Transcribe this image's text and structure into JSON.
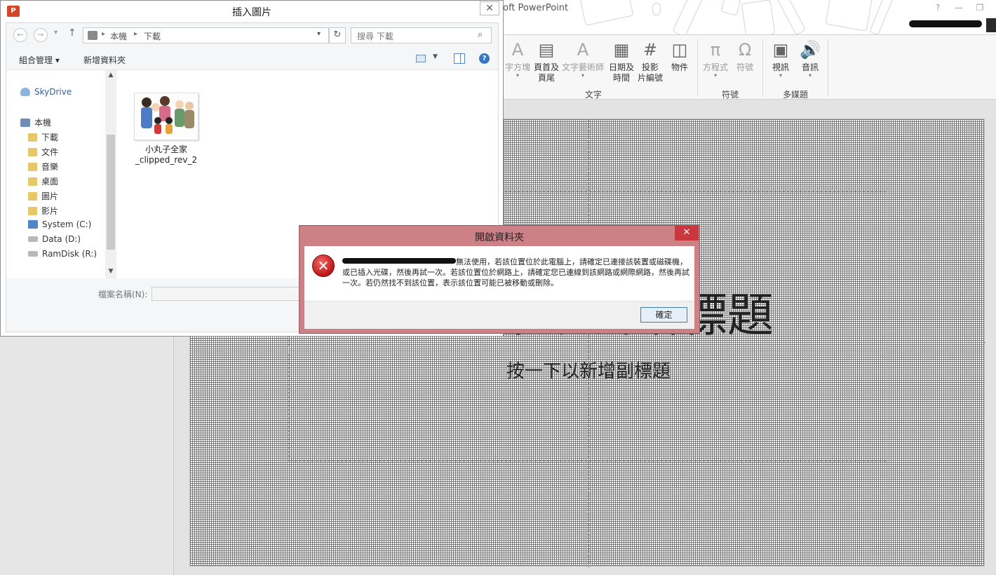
{
  "ppt": {
    "title_fragment": "oft PowerPoint",
    "window_controls": {
      "help": "?",
      "minimize": "—",
      "restore": "❐"
    },
    "ribbon": {
      "buttons": [
        {
          "label": "字方塊",
          "icon": "A",
          "dim": true
        },
        {
          "label": "頁首及\n頁尾",
          "icon": "▤"
        },
        {
          "label": "文字藝術師",
          "icon": "A",
          "dim": true
        },
        {
          "label": "日期及\n時間",
          "icon": "▦"
        },
        {
          "label": "投影\n片編號",
          "icon": "#"
        },
        {
          "label": "物件",
          "icon": "◫"
        },
        {
          "label": "方程式",
          "icon": "π",
          "dim": true
        },
        {
          "label": "符號",
          "icon": "Ω",
          "dim": true
        },
        {
          "label": "視訊",
          "icon": "▣"
        },
        {
          "label": "音訊",
          "icon": "🔊"
        }
      ],
      "groups": {
        "text": "文字",
        "symbols": "符號",
        "media": "多媒題"
      }
    },
    "slide": {
      "title_placeholder": "按一下以新增標題",
      "title_visible_suffix": "標題",
      "subtitle_placeholder": "按一下以新增副標題"
    }
  },
  "insert_dialog": {
    "app_icon": "P",
    "title": "插入圖片",
    "close": "✕",
    "nav": {
      "back": "←",
      "forward": "→",
      "recent": "▾",
      "up": "↑"
    },
    "breadcrumb": [
      "本機",
      "下載"
    ],
    "refresh": "↻",
    "search_placeholder": "搜尋 下載",
    "search_icon": "⌕",
    "commands": {
      "organize": "組合管理 ▾",
      "new_folder": "新增資料夾"
    },
    "help_icon": "?",
    "tree": [
      {
        "label": "SkyDrive",
        "icon": "cloud"
      },
      {
        "label": "本機",
        "icon": "pc"
      },
      {
        "label": "下載",
        "icon": "folder"
      },
      {
        "label": "文件",
        "icon": "folder"
      },
      {
        "label": "音樂",
        "icon": "folder"
      },
      {
        "label": "桌面",
        "icon": "folder"
      },
      {
        "label": "圖片",
        "icon": "folder"
      },
      {
        "label": "影片",
        "icon": "folder"
      },
      {
        "label": "System (C:)",
        "icon": "sys"
      },
      {
        "label": "Data (D:)",
        "icon": "drive"
      },
      {
        "label": "RamDisk (R:)",
        "icon": "drive"
      }
    ],
    "scroll_up": "▲",
    "scroll_down": "▼",
    "files": [
      {
        "name": "小丸子全家_clipped_rev_2"
      }
    ],
    "filename_label": "檔案名稱(N):",
    "filename_value": ""
  },
  "error_dialog": {
    "title": "開啟資料夾",
    "close": "✕",
    "icon": "✕",
    "message": "無法使用，若該位置位於此電腦上，請確定已連接該裝置或磁碟機，或已插入光碟，然後再試一次。若該位置位於網路上，請確定您已連線到該網路或網際網路，然後再試一次。若仍然找不到該位置，表示該位置可能已被移動或刪除。",
    "ok_label": "確定"
  },
  "colors": {
    "ppt_accent": "#d24726",
    "error_frame": "#cd8085",
    "error_close": "#c9383e",
    "link_blue": "#3574c6"
  }
}
